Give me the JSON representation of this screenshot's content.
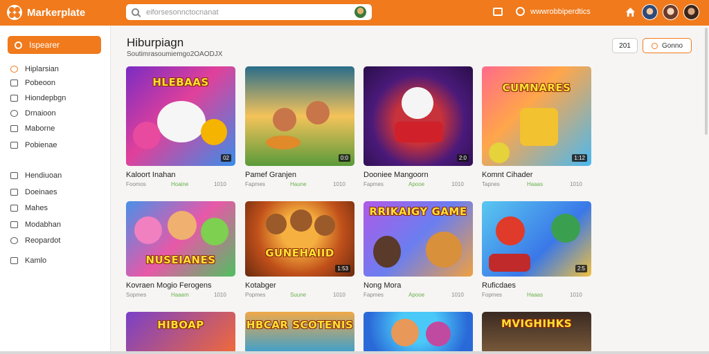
{
  "app": {
    "brand": "Markerplate"
  },
  "search": {
    "value": "eiforsesonnctocnanat"
  },
  "topbar": {
    "link": "wwwrobbiperdtics"
  },
  "sidebar": {
    "primary_button": "Ispearer",
    "items": [
      {
        "label": "Hiplarsian",
        "active": true
      },
      {
        "label": "Pobeoon"
      },
      {
        "label": "Hiondepbgn"
      },
      {
        "label": "Drnaioon"
      },
      {
        "label": "Maborne"
      },
      {
        "label": "Pobienae"
      },
      {
        "label": "Hendiuoan"
      },
      {
        "label": "Doeinaes"
      },
      {
        "label": "Mahes"
      },
      {
        "label": "Modabhan"
      },
      {
        "label": "Reopardot"
      },
      {
        "label": "Kamlo"
      }
    ]
  },
  "main": {
    "title": "Hiburpiagn",
    "subtitle": "Soutimrasoumiemgo2OAODJX",
    "btn_small": "201",
    "btn_orange": "Gonno"
  },
  "cards": [
    {
      "title": "Kaloort Inahan",
      "m1": "Foomos",
      "m2": "Hoaine",
      "m3": "1010",
      "duration": "02",
      "thumb_text": "HLEBAAS"
    },
    {
      "title": "Pamef Granjen",
      "m1": "Fapmes",
      "m2": "Haune",
      "m3": "1010",
      "duration": "0:0",
      "thumb_text": ""
    },
    {
      "title": "Dooniee Mangoorn",
      "m1": "Fapmes",
      "m2": "Apooe",
      "m3": "1010",
      "duration": "2:0",
      "thumb_text": ""
    },
    {
      "title": "Komnt Cihader",
      "m1": "Tapnes",
      "m2": "Haaas",
      "m3": "1010",
      "duration": "1:12",
      "thumb_text": "CUMNARES"
    },
    {
      "title": "Kovraen Mogio Ferogens",
      "m1": "Sopmes",
      "m2": "Haaam",
      "m3": "1010",
      "duration": "",
      "thumb_text": "NUSEIANES"
    },
    {
      "title": "Kotabger",
      "m1": "Popmes",
      "m2": "Suune",
      "m3": "1010",
      "duration": "1:53",
      "thumb_text": "GUNEHAIID"
    },
    {
      "title": "Nong Mora",
      "m1": "Fapmes",
      "m2": "Apooe",
      "m3": "1010",
      "duration": "",
      "thumb_text": "RRIKAIGY GAME"
    },
    {
      "title": "Ruficdaes",
      "m1": "Fopmes",
      "m2": "Haaas",
      "m3": "1010",
      "duration": "2:5",
      "thumb_text": ""
    },
    {
      "title": "",
      "m1": "",
      "m2": "",
      "m3": "",
      "duration": "",
      "thumb_text": "HIBOAP"
    },
    {
      "title": "",
      "m1": "",
      "m2": "",
      "m3": "",
      "duration": "",
      "thumb_text": "HBCAR SCOTENIS"
    },
    {
      "title": "",
      "m1": "",
      "m2": "",
      "m3": "",
      "duration": "",
      "thumb_text": ""
    },
    {
      "title": "",
      "m1": "",
      "m2": "",
      "m3": "",
      "duration": "",
      "thumb_text": "MVIGHIHKS"
    }
  ]
}
